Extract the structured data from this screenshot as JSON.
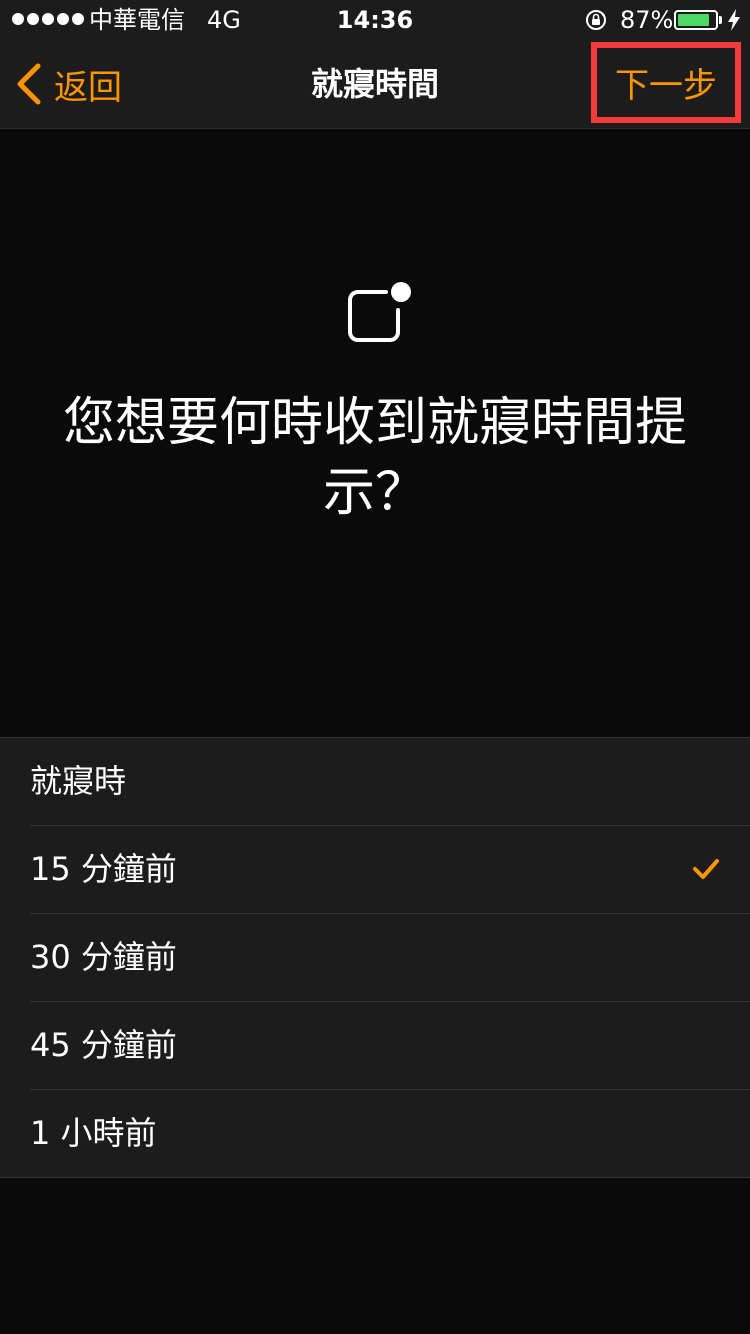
{
  "status_bar": {
    "carrier": "中華電信",
    "network": "4G",
    "time": "14:36",
    "battery_percent": "87%",
    "battery_level": 0.87,
    "battery_color": "#4cd964"
  },
  "nav": {
    "back_label": "返回",
    "title": "就寢時間",
    "next_label": "下一步",
    "accent_color": "#ff9500",
    "highlight_color": "#f23b3b"
  },
  "hero": {
    "icon": "notification-icon",
    "prompt": "您想要何時收到就寢時間提示？"
  },
  "options": [
    {
      "label": "就寢時",
      "selected": false
    },
    {
      "label": "15 分鐘前",
      "selected": true
    },
    {
      "label": "30 分鐘前",
      "selected": false
    },
    {
      "label": "45 分鐘前",
      "selected": false
    },
    {
      "label": "1 小時前",
      "selected": false
    }
  ]
}
